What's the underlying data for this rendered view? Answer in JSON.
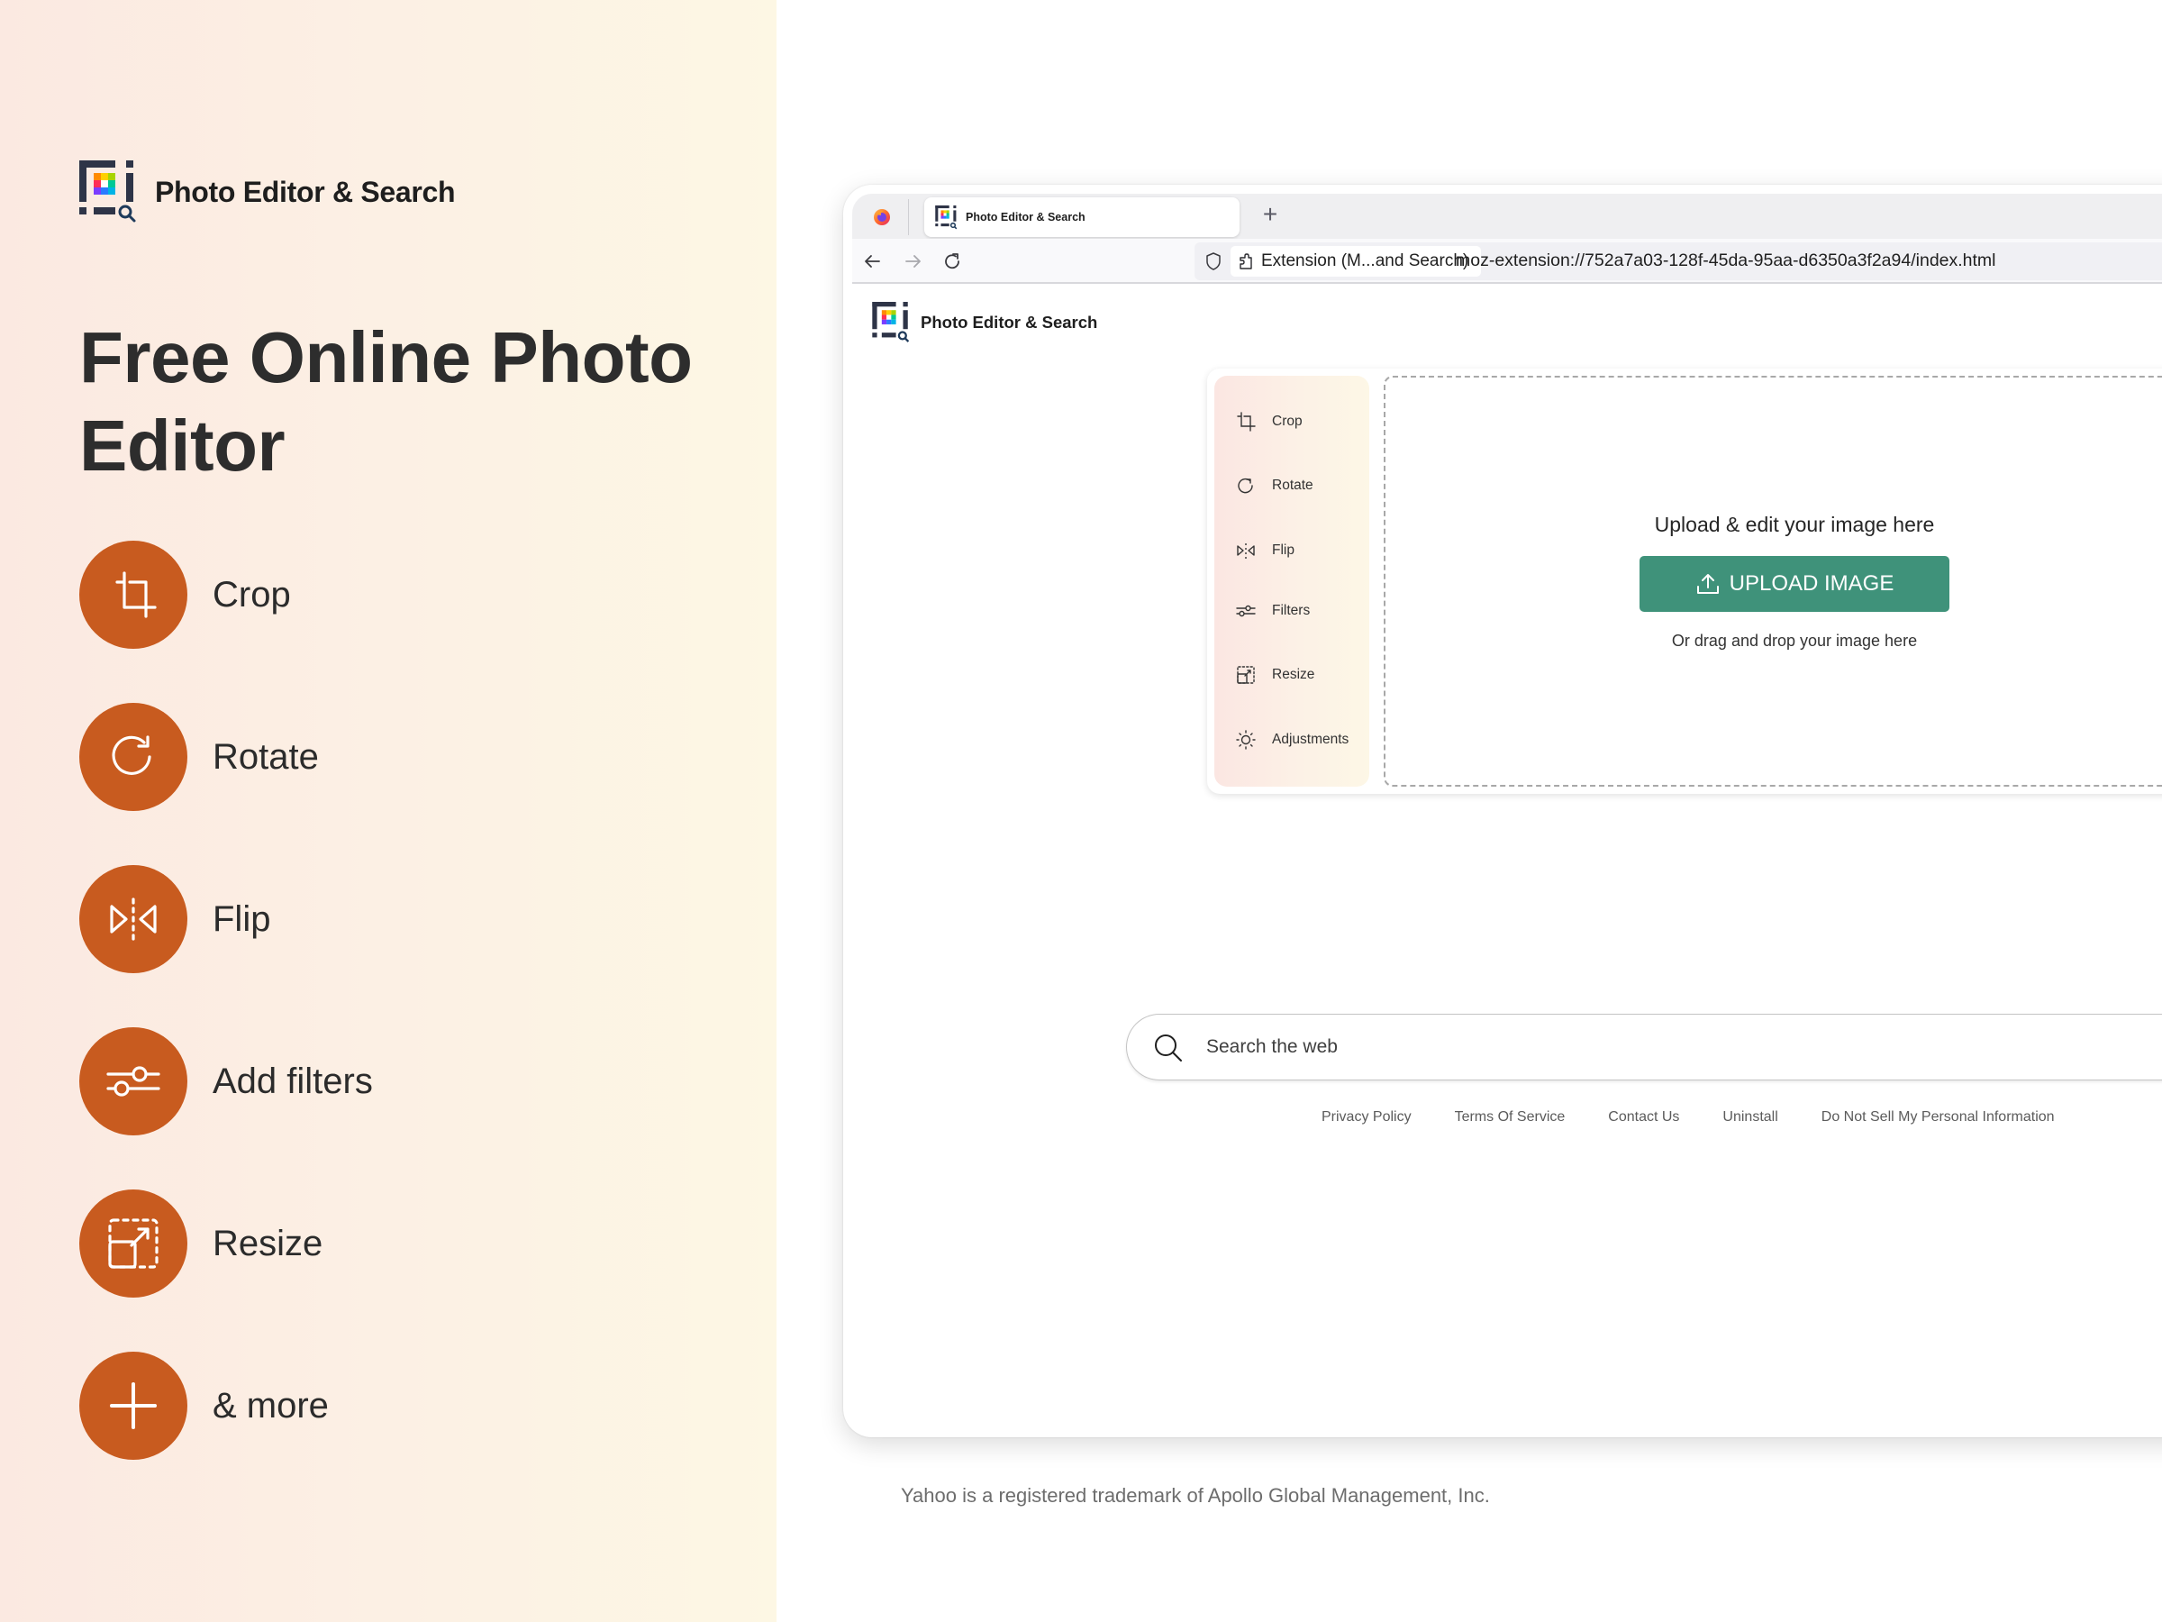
{
  "promo": {
    "brand_name": "Photo Editor & Search",
    "headline": "Free Online Photo Editor",
    "accent_color": "#c85b1f",
    "features": [
      {
        "label": "Crop",
        "icon": "crop-icon"
      },
      {
        "label": "Rotate",
        "icon": "rotate-icon"
      },
      {
        "label": "Flip",
        "icon": "flip-icon"
      },
      {
        "label": "Add filters",
        "icon": "filters-icon"
      },
      {
        "label": "Resize",
        "icon": "resize-icon"
      },
      {
        "label": "& more",
        "icon": "plus-icon"
      }
    ]
  },
  "browser": {
    "tab_title": "Photo Editor & Search",
    "new_tab_label": "+",
    "extension_chip": "Extension (M...and Search)",
    "url": "moz-extension://752a7a03-128f-45da-95aa-d6350a3f2a94/index.html"
  },
  "page": {
    "brand_name": "Photo Editor & Search",
    "tools": [
      {
        "label": "Crop",
        "icon": "crop-icon"
      },
      {
        "label": "Rotate",
        "icon": "rotate-icon"
      },
      {
        "label": "Flip",
        "icon": "flip-icon"
      },
      {
        "label": "Filters",
        "icon": "filters-icon"
      },
      {
        "label": "Resize",
        "icon": "resize-icon"
      },
      {
        "label": "Adjustments",
        "icon": "sun-icon"
      }
    ],
    "upload": {
      "title": "Upload & edit your image here",
      "button_label": "UPLOAD IMAGE",
      "hint": "Or drag and drop your image here",
      "button_color": "#3f927a"
    },
    "search": {
      "placeholder": "Search the web",
      "value": ""
    },
    "footer_links": [
      "Privacy Policy",
      "Terms Of Service",
      "Contact Us",
      "Uninstall",
      "Do Not Sell My Personal Information"
    ]
  },
  "trademark": "Yahoo is a registered trademark of Apollo Global Management, Inc."
}
